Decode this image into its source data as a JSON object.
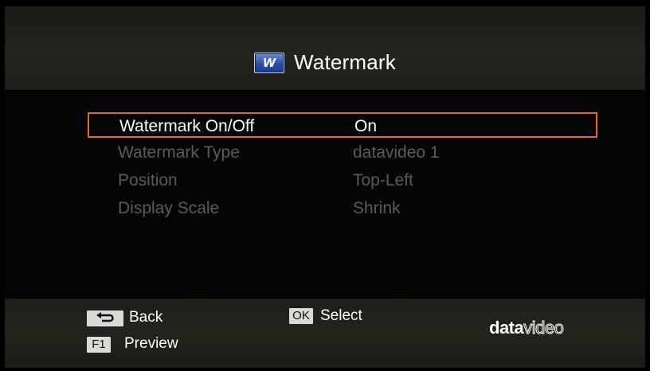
{
  "header": {
    "icon_letter": "W",
    "title": "Watermark"
  },
  "menu": {
    "items": [
      {
        "label": "Watermark On/Off",
        "value": "On",
        "selected": true
      },
      {
        "label": "Watermark Type",
        "value": "datavideo 1",
        "selected": false
      },
      {
        "label": "Position",
        "value": "Top-Left",
        "selected": false
      },
      {
        "label": "Display Scale",
        "value": "Shrink",
        "selected": false
      }
    ]
  },
  "footer": {
    "back_label": "Back",
    "ok_key": "OK",
    "select_label": "Select",
    "f1_key": "F1",
    "preview_label": "Preview",
    "brand_bold": "data",
    "brand_outline": "video"
  },
  "colors": {
    "selection_border": "#e06a1a",
    "active_text": "#ffffff",
    "dim_text": "#5b5b5b",
    "bar_background": "#22211b"
  },
  "icons": [
    "watermark-w-icon",
    "back-arrow-icon"
  ]
}
